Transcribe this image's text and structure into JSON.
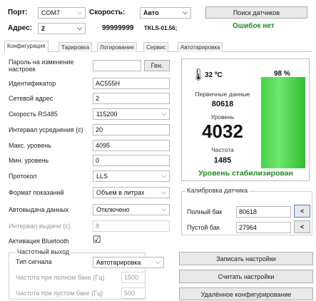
{
  "top": {
    "port_label": "Порт:",
    "port_value": "COM7",
    "speed_label": "Скорость:",
    "speed_value": "Авто",
    "search_button": "Поиск датчиков",
    "address_label": "Адрес:",
    "address_value": "2",
    "serial": "99999999",
    "model": "TKLS-01.56;",
    "errors": "Ошибок нет"
  },
  "tabs": [
    {
      "label": "Конфигурация"
    },
    {
      "label": "Тарировка"
    },
    {
      "label": "Логирование"
    },
    {
      "label": "Сервис"
    },
    {
      "label": "Автотарировка"
    }
  ],
  "config": {
    "password_label": "Пароль на изменение настроек",
    "password_value": "",
    "generate_button": "Ген.",
    "id_label": "Идентификатор",
    "id_value": "AC555H",
    "netaddr_label": "Сетевой адрес",
    "netaddr_value": "2",
    "rs485_label": "Скорость RS485",
    "rs485_value": "115200",
    "avg_label": "Интервал усреднения (с)",
    "avg_value": "20",
    "max_label": "Макс. уровень",
    "max_value": "4095",
    "min_label": "Мин. уровень",
    "min_value": "0",
    "protocol_label": "Протокол",
    "protocol_value": "LLS",
    "format_label": "Формат показаний",
    "format_value": "Объем в литрах",
    "autosend_label": "Автовыдача данных",
    "autosend_value": "Отключено",
    "interval_label": "Интервал выдачи (с)",
    "interval_value": "8",
    "bt_label": "Активация Bluetooth",
    "bt_checked": "☑",
    "freq_group_title": "Частотный выход",
    "signal_type_label": "Тип сигнала",
    "signal_type_value": "Автотарировка",
    "freq_full_label": "Частота при полном баке (Гц)",
    "freq_full_value": "1500",
    "freq_empty_label": "Частота при пустом баке (Гц)",
    "freq_empty_value": "500"
  },
  "status": {
    "temperature": "32 ºC",
    "percent": "98 %",
    "percent_value": 98,
    "primary_label": "Первичные данные",
    "primary_value": "80618",
    "level_label": "Уровень",
    "level_value": "4032",
    "freq_label": "Частота",
    "freq_value": "1485",
    "stable": "Уровень стабилизирован",
    "bar_color": "#3cc83c",
    "stable_color": "#1e8c1e"
  },
  "calibration": {
    "title": "Калибровка датчика",
    "full_label": "Полный бак",
    "full_value": "80618",
    "empty_label": "Пустой бак",
    "empty_value": "27964",
    "set_icon": "<"
  },
  "actions": {
    "write": "Записать настройки",
    "read": "Считать настройки",
    "remote": "Удалённое конфигурирование"
  }
}
